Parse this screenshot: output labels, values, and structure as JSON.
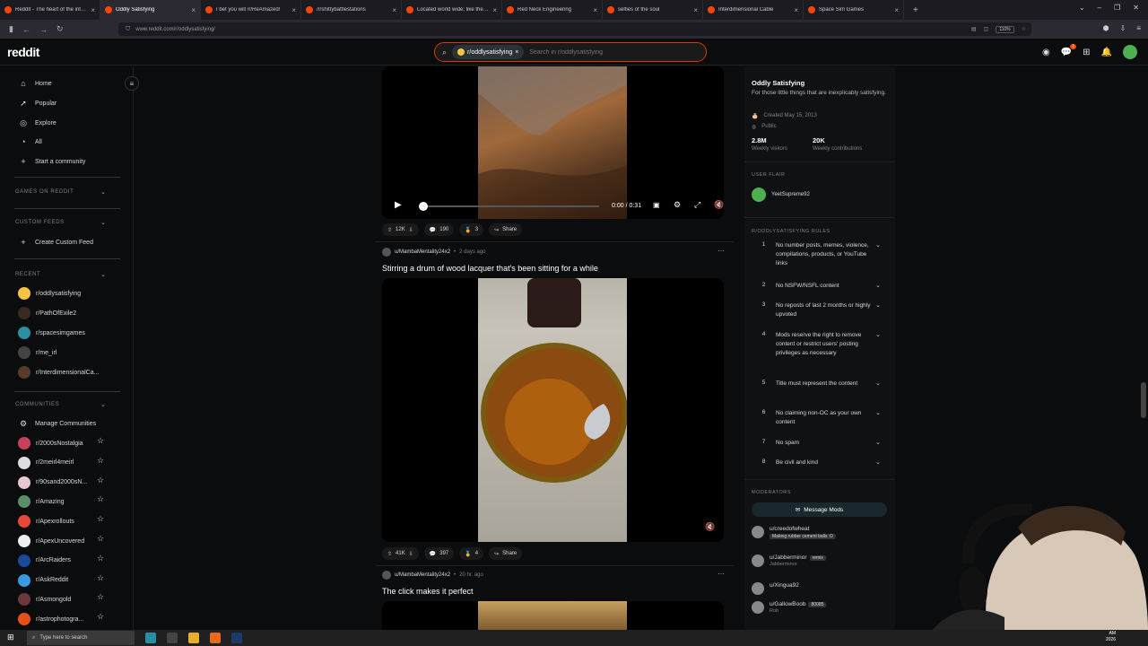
{
  "browser": {
    "tabs": [
      {
        "title": "Reddit - The heart of the internet",
        "active": false
      },
      {
        "title": "Oddly Satisfying",
        "active": true
      },
      {
        "title": "I bet you will /r/ReAmazed!",
        "active": false
      },
      {
        "title": "/r/shittybattlestations",
        "active": false
      },
      {
        "title": "Located world wide; like the ants",
        "active": false
      },
      {
        "title": "Red Neck Engineering",
        "active": false
      },
      {
        "title": "selfies of the soul",
        "active": false
      },
      {
        "title": "Interdimensional Cable",
        "active": false
      },
      {
        "title": "Space Sim Games",
        "active": false
      }
    ],
    "url": "www.reddit.com/r/oddlysatisfying/",
    "zoom": "110%"
  },
  "header": {
    "logo": "reddit",
    "search_chip": "r/oddlysatisfying",
    "search_placeholder": "Search in r/oddlysatisfying",
    "notification_count": "1"
  },
  "sidebar": {
    "nav": [
      {
        "label": "Home",
        "icon": "home-icon"
      },
      {
        "label": "Popular",
        "icon": "popular-icon"
      },
      {
        "label": "Explore",
        "icon": "explore-icon"
      },
      {
        "label": "All",
        "icon": "all-icon"
      },
      {
        "label": "Start a community",
        "icon": "plus-icon"
      }
    ],
    "games_heading": "GAMES ON REDDIT",
    "custom_feeds_heading": "CUSTOM FEEDS",
    "create_custom_feed": "Create Custom Feed",
    "recent_heading": "RECENT",
    "recent": [
      {
        "label": "r/oddlysatisfying",
        "color": "#f5c542"
      },
      {
        "label": "r/PathOfExile2",
        "color": "#3a2a20"
      },
      {
        "label": "r/spacesimgames",
        "color": "#2a8fa0"
      },
      {
        "label": "r/me_irl",
        "color": "#444444"
      },
      {
        "label": "r/InterdimensionalCa...",
        "color": "#5a3a2a"
      }
    ],
    "communities_heading": "COMMUNITIES",
    "manage_communities": "Manage Communities",
    "communities": [
      {
        "label": "r/2000sNostalgia",
        "color": "#c8415a"
      },
      {
        "label": "r/2meirl4meirl",
        "color": "#dddddd"
      },
      {
        "label": "r/90sand2000sN...",
        "color": "#e8c8d0"
      },
      {
        "label": "r/Amazing",
        "color": "#5a8f6a"
      },
      {
        "label": "r/Apexrollouts",
        "color": "#e84a3a"
      },
      {
        "label": "r/ApexUncovered",
        "color": "#eeeeee"
      },
      {
        "label": "r/ArcRaiders",
        "color": "#1a4a9a"
      },
      {
        "label": "r/AskReddit",
        "color": "#3a9adf"
      },
      {
        "label": "r/Asmongold",
        "color": "#6a3a3a"
      },
      {
        "label": "r/astrophotogra...",
        "color": "#e8501a"
      }
    ]
  },
  "feed": {
    "post1": {
      "time_display": "0:00 / 0:31",
      "upvotes": "12K",
      "comments": "190",
      "awards": "3",
      "share": "Share"
    },
    "post2": {
      "author": "u/MambaMentality24x2",
      "time": "2 days ago",
      "title": "Stirring a drum of wood lacquer that's been sitting for a while",
      "upvotes": "41K",
      "comments": "397",
      "awards": "4",
      "share": "Share"
    },
    "post3": {
      "author": "u/MambaMentality24x2",
      "time": "20 hr. ago",
      "title": "The click makes it perfect"
    }
  },
  "rightbar": {
    "name": "Oddly Satisfying",
    "description": "For those little things that are inexplicably satisfying.",
    "created": "Created May 15, 2013",
    "visibility": "Public",
    "visitors_value": "2.8M",
    "visitors_label": "Weekly visitors",
    "contrib_value": "20K",
    "contrib_label": "Weekly contributions",
    "user_flair_heading": "USER FLAIR",
    "user_flair_name": "YeetSupreme92",
    "rules_heading": "R/ODDLYSATISFYING RULES",
    "rules": [
      {
        "num": "1",
        "text": "No number posts, memes, violence, compilations, products, or YouTube links"
      },
      {
        "num": "2",
        "text": "No NSFW/NSFL content"
      },
      {
        "num": "3",
        "text": "No reposts of last 2 months or highly upvoted"
      },
      {
        "num": "4",
        "text": "Mods reserve the right to remove content or restrict users' posting privileges as necessary"
      },
      {
        "num": "5",
        "text": "Title must represent the content"
      },
      {
        "num": "6",
        "text": "No claiming non-OC as your own content"
      },
      {
        "num": "7",
        "text": "No spam"
      },
      {
        "num": "8",
        "text": "Be civil and kind"
      }
    ],
    "moderators_heading": "MODERATORS",
    "message_mods": "Message Mods",
    "moderators": [
      {
        "name": "u/creedofwheat",
        "flair": "Making rubber cement balls :D",
        "sub": ""
      },
      {
        "name": "u/Jabberminor",
        "flair": "remix",
        "sub": "Jabberminor"
      },
      {
        "name": "u/Xingua92",
        "flair": "",
        "sub": ""
      },
      {
        "name": "u/GallowBoob",
        "flair": "80085",
        "sub": "Rob"
      }
    ]
  },
  "taskbar": {
    "search_placeholder": "Type here to search",
    "clock_time": "AM",
    "clock_date": "2026"
  }
}
